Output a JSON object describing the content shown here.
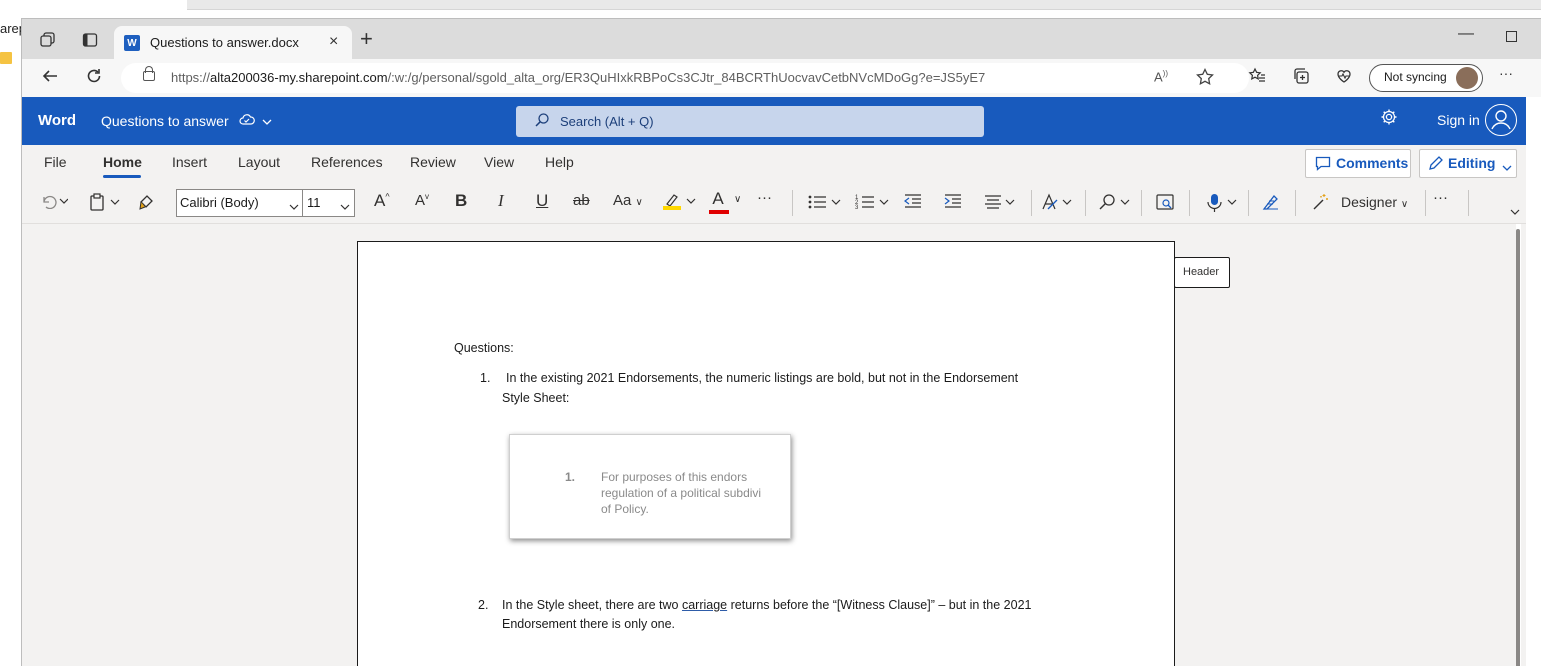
{
  "background": {
    "left_text": "arep"
  },
  "browser": {
    "tab": {
      "title": "Questions to answer.docx",
      "favicon_letter": "W",
      "close_symbol": "×"
    },
    "new_tab_symbol": "+",
    "minimize_symbol": "—",
    "address": {
      "url_prefix": "https://",
      "url_domain": "alta200036-my.sharepoint.com",
      "url_path": "/:w:/g/personal/sgold_alta_org/ER3QuHIxkRBPoCs3CJtr_84BCRThUocvavCetbNVcMDoGg?e=JS5yE7"
    },
    "sync_label": "Not syncing",
    "more_symbol": "···"
  },
  "word": {
    "brand": "Word",
    "doc_title": "Questions to answer",
    "search_placeholder": "Search (Alt + Q)",
    "signin_label": "Sign in"
  },
  "menu": {
    "items": [
      "File",
      "Home",
      "Insert",
      "Layout",
      "References",
      "Review",
      "View",
      "Help"
    ],
    "comments_label": "Comments",
    "editing_label": "Editing"
  },
  "toolbar": {
    "font_name": "Calibri (Body)",
    "font_size": "11",
    "grow_font": "A",
    "shrink_font": "A",
    "bold": "B",
    "italic": "I",
    "underline": "U",
    "strike": "ab",
    "case": "Aa",
    "font_color": "A",
    "more": "···",
    "designer_label": "Designer"
  },
  "document": {
    "header_tag": "Header",
    "questions_title": "Questions:",
    "q1_number": "1.",
    "q1_line1": "In the existing 2021 Endorsements, the numeric listings are bold, but not in the Endorsement",
    "q1_line2": "Style Sheet:",
    "embedded_image": {
      "number": "1.",
      "line1": "For purposes of this endors",
      "line2": "regulation of a political subdivi",
      "line3": "of Policy."
    },
    "q2_number": "2.",
    "q2_line1_a": "In the Style sheet, there are two ",
    "q2_line1_underlined": "carriage",
    "q2_line1_b": " returns before the “[Witness Clause]” – but in the 2021",
    "q2_line2": "Endorsement there is only one."
  },
  "colors": {
    "word_blue": "#185abd",
    "highlight_yellow": "#ffd800",
    "font_red": "#e00000"
  }
}
